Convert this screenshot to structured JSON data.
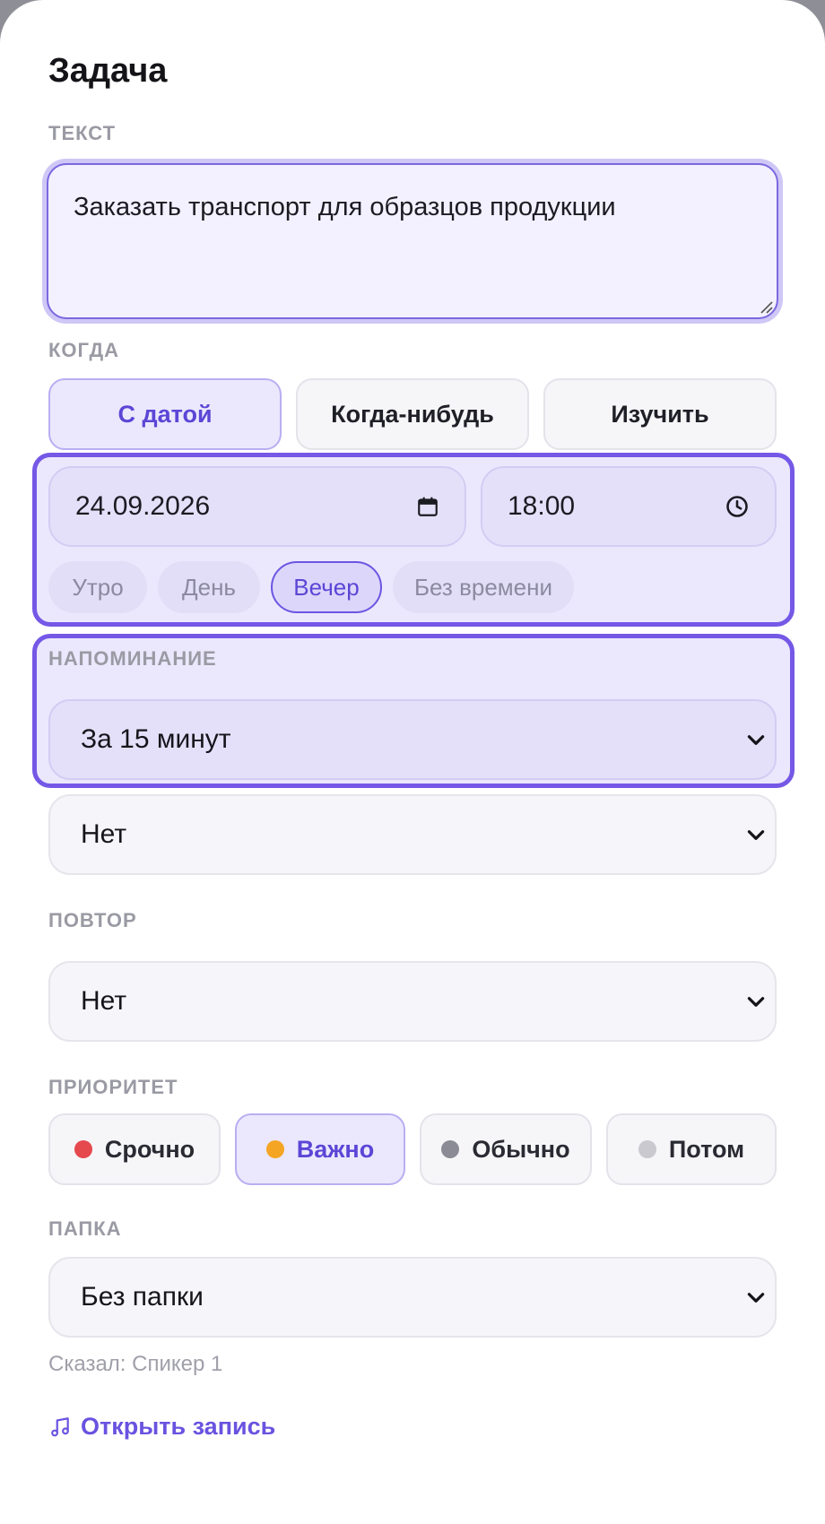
{
  "title": "Задача",
  "text_section": {
    "label": "ТЕКСТ",
    "value": "Заказать транспорт для образцов продукции"
  },
  "when_section": {
    "label": "КОГДА",
    "modes": [
      {
        "label": "С датой",
        "active": true
      },
      {
        "label": "Когда-нибудь",
        "active": false
      },
      {
        "label": "Изучить",
        "active": false
      }
    ],
    "date": "24.09.2026",
    "time": "18:00",
    "time_chips": [
      {
        "label": "Утро",
        "active": false
      },
      {
        "label": "День",
        "active": false
      },
      {
        "label": "Вечер",
        "active": true
      },
      {
        "label": "Без времени",
        "active": false
      }
    ]
  },
  "reminder_section": {
    "label": "НАПОМИНАНИЕ",
    "primary": "За 15 минут",
    "secondary": "Нет"
  },
  "repeat_section": {
    "label": "ПОВТОР",
    "value": "Нет"
  },
  "priority_section": {
    "label": "ПРИОРИТЕТ",
    "options": [
      {
        "label": "Срочно",
        "color": "#e5484d",
        "active": false
      },
      {
        "label": "Важно",
        "color": "#f5a524",
        "active": true
      },
      {
        "label": "Обычно",
        "color": "#8b8b95",
        "active": false
      },
      {
        "label": "Потом",
        "color": "#c9c9cf",
        "active": false
      }
    ]
  },
  "folder_section": {
    "label": "ПАПКА",
    "value": "Без папки"
  },
  "speaker": "Сказал: Спикер 1",
  "open_record": {
    "icon": "music-note-icon",
    "label": "Открыть запись"
  },
  "colors": {
    "accent": "#7558e6",
    "accent_text": "#5b46d6",
    "active_bg": "#ebe8fd"
  }
}
